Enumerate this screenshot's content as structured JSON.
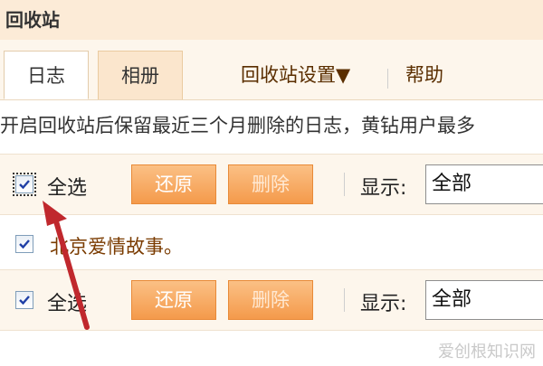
{
  "header": {
    "title": "回收站"
  },
  "tabs": {
    "diary": "日志",
    "album": "相册",
    "settings": "回收站设置▼",
    "help": "帮助"
  },
  "notice": "开启回收站后保留最近三个月删除的日志，黄钻用户最多",
  "toolbar": {
    "select_all": "全选",
    "restore": "还原",
    "delete": "删除",
    "display_label": "显示:",
    "display_value": "全部"
  },
  "entries": [
    {
      "title": "北京爱情故事。"
    }
  ],
  "watermark": "爱创根知识网",
  "colors": {
    "accent_orange": "#f49a4b",
    "header_bg": "#fcebd7",
    "annotation_arrow": "#c0282d"
  }
}
